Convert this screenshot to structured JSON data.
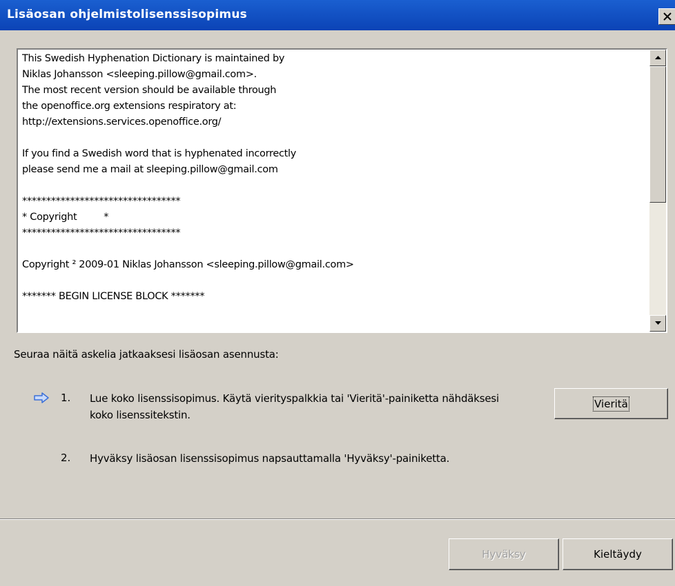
{
  "window": {
    "title": "Lisäosan ohjelmistolisenssisopimus",
    "close_icon": "close-icon"
  },
  "license": {
    "lines": [
      "This Swedish Hyphenation Dictionary is maintained by",
      "Niklas Johansson <sleeping.pillow@gmail.com>.",
      "The most recent version should be available through",
      "the openoffice.org extensions respiratory at:",
      "http://extensions.services.openoffice.org/",
      "",
      "If you find a Swedish word that is hyphenated incorrectly",
      "please send me a mail at sleeping.pillow@gmail.com",
      "",
      "*********************************",
      "* Copyright         *",
      "*********************************",
      "",
      "Copyright ² 2009-01 Niklas Johansson <sleeping.pillow@gmail.com>",
      "",
      "******* BEGIN LICENSE BLOCK *******"
    ]
  },
  "instructions": {
    "heading": "Seuraa näitä askelia jatkaaksesi lisäosan asennusta:",
    "steps": [
      {
        "number": "1.",
        "text_line1": "Lue koko lisenssisopimus. Käytä vierityspalkkia tai 'Vieritä'-painiketta nähdäksesi",
        "text_line2": "koko lisenssitekstin."
      },
      {
        "number": "2.",
        "text_line1": "Hyväksy lisäosan lisenssisopimus napsauttamalla 'Hyväksy'-painiketta."
      }
    ],
    "scroll_button_label": "Vieritä"
  },
  "footer": {
    "accept_label": "Hyväksy",
    "decline_label": "Kieltäydy"
  },
  "colors": {
    "titlebar": "#0b43b6",
    "dialog_bg": "#d4d0c8",
    "arrow": "#3a6fd8"
  }
}
